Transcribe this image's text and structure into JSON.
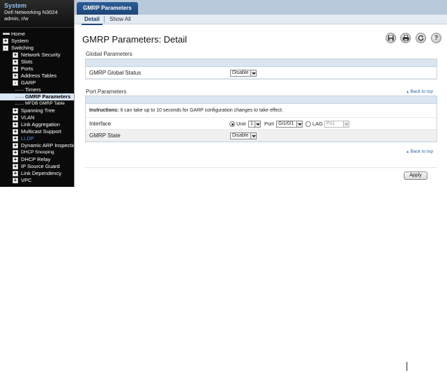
{
  "sidebar": {
    "title": "System",
    "device": "Dell Networking N3024",
    "user": "admin, r/w",
    "tree": [
      {
        "label": "Home",
        "name": "tree-home"
      },
      {
        "label": "System",
        "name": "tree-system"
      },
      {
        "label": "Switching",
        "name": "tree-switching"
      },
      {
        "label": "Network Security",
        "name": "tree-network-security"
      },
      {
        "label": "Slots",
        "name": "tree-slots"
      },
      {
        "label": "Ports",
        "name": "tree-ports"
      },
      {
        "label": "Address Tables",
        "name": "tree-address-tables"
      },
      {
        "label": "GARP",
        "name": "tree-garp"
      },
      {
        "label": "Timers",
        "name": "tree-timers"
      },
      {
        "label": "GMRP Parameters",
        "name": "tree-gmrp-parameters"
      },
      {
        "label": "MFDB GMRP Table",
        "name": "tree-mfdb-gmrp-table"
      },
      {
        "label": "Spanning Tree",
        "name": "tree-spanning-tree"
      },
      {
        "label": "VLAN",
        "name": "tree-vlan"
      },
      {
        "label": "Link Aggregation",
        "name": "tree-link-aggregation"
      },
      {
        "label": "Multicast Support",
        "name": "tree-multicast-support"
      },
      {
        "label": "LLDP",
        "name": "tree-lldp"
      },
      {
        "label": "Dynamic ARP Inspection",
        "name": "tree-dynamic-arp-inspection"
      },
      {
        "label": "DHCP Snooping",
        "name": "tree-dhcp-snooping"
      },
      {
        "label": "DHCP Relay",
        "name": "tree-dhcp-relay"
      },
      {
        "label": "IP Source Guard",
        "name": "tree-ip-source-guard"
      },
      {
        "label": "Link Dependency",
        "name": "tree-link-dependency"
      },
      {
        "label": "VPC",
        "name": "tree-vpc"
      }
    ]
  },
  "tabs": {
    "main": "GMRP Parameters",
    "detail": "Detail",
    "show_all": "Show All"
  },
  "page": {
    "title": "GMRP Parameters: Detail",
    "icons": [
      "save-icon",
      "print-icon",
      "refresh-icon",
      "help-icon"
    ]
  },
  "global": {
    "section": "Global Parameters",
    "status_label": "GMRP Global Status",
    "status_value": "Disable"
  },
  "port": {
    "section": "Port Parameters",
    "back_to_top": "Back to top",
    "instructions_bold": "Instructions:",
    "instructions_text": " It can take up to 10 seconds for GARP configuration changes to take effect.",
    "interface_label": "Interface",
    "unit_label": "Unit",
    "unit_value": "1",
    "port_label": "Port",
    "port_value": "Gi1/0/1",
    "lag_label": "LAG",
    "lag_value": "Po1",
    "state_label": "GMRP State",
    "state_value": "Disable"
  },
  "footer": {
    "back_to_top": "Back to top",
    "apply": "Apply"
  }
}
